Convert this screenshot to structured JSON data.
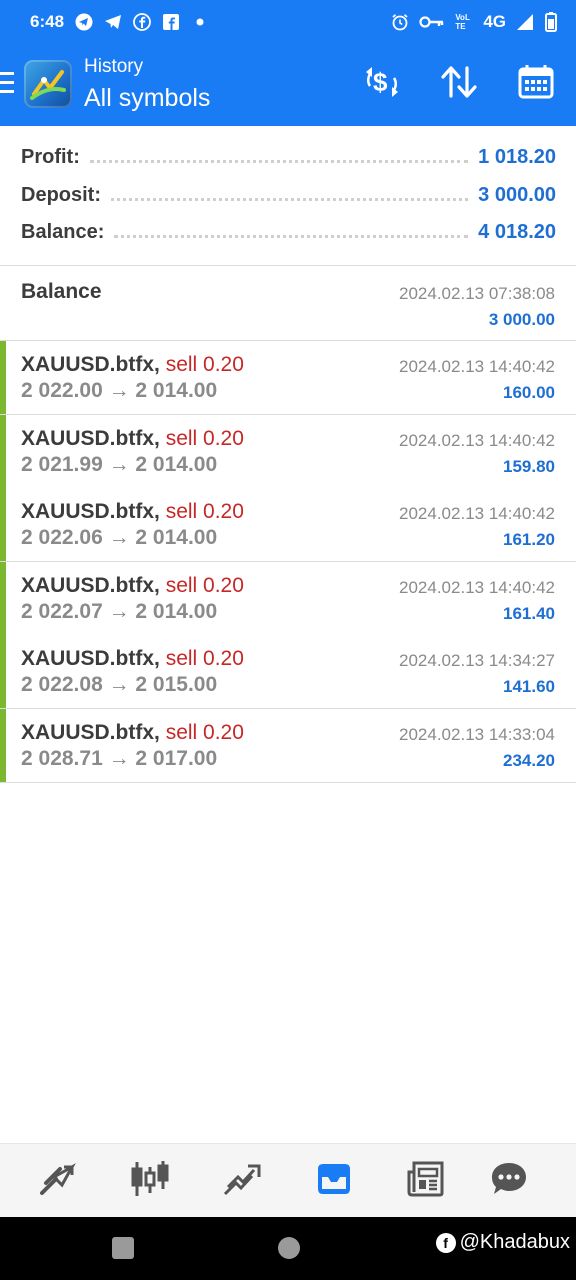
{
  "status_bar": {
    "time": "6:48",
    "network": "4G",
    "volte": "VoLTE"
  },
  "app_bar": {
    "subtitle": "History",
    "title": "All symbols"
  },
  "summary": [
    {
      "label": "Profit:",
      "value": "1 018.20"
    },
    {
      "label": "Deposit:",
      "value": "3 000.00"
    },
    {
      "label": "Balance:",
      "value": "4 018.20"
    }
  ],
  "balance_entry": {
    "label": "Balance",
    "time": "2024.02.13 07:38:08",
    "amount": "3 000.00"
  },
  "deals": [
    {
      "symbol": "XAUUSD.btfx,",
      "side": "sell 0.20",
      "prices": "2 022.00 → 2 014.00",
      "time": "2024.02.13 14:40:42",
      "profit": "160.00"
    },
    {
      "symbol": "XAUUSD.btfx,",
      "side": "sell 0.20",
      "prices": "2 021.99 → 2 014.00",
      "time": "2024.02.13 14:40:42",
      "profit": "159.80"
    },
    {
      "symbol": "XAUUSD.btfx,",
      "side": "sell 0.20",
      "prices": "2 022.06 → 2 014.00",
      "time": "2024.02.13 14:40:42",
      "profit": "161.20"
    },
    {
      "symbol": "XAUUSD.btfx,",
      "side": "sell 0.20",
      "prices": "2 022.07 → 2 014.00",
      "time": "2024.02.13 14:40:42",
      "profit": "161.40"
    },
    {
      "symbol": "XAUUSD.btfx,",
      "side": "sell 0.20",
      "prices": "2 022.08 → 2 015.00",
      "time": "2024.02.13 14:34:27",
      "profit": "141.60"
    },
    {
      "symbol": "XAUUSD.btfx,",
      "side": "sell 0.20",
      "prices": "2 028.71 → 2 017.00",
      "time": "2024.02.13 14:33:04",
      "profit": "234.20"
    }
  ],
  "watermark": "@Khadabux",
  "colors": {
    "brand_blue": "#1a7cf5",
    "value_blue": "#1f6fd3",
    "sell_red": "#c62828",
    "deal_bar_green": "#7cb82f"
  },
  "bottom_nav": [
    "quotes-icon",
    "chart-icon",
    "trade-icon",
    "history-icon",
    "news-icon",
    "chat-icon"
  ]
}
